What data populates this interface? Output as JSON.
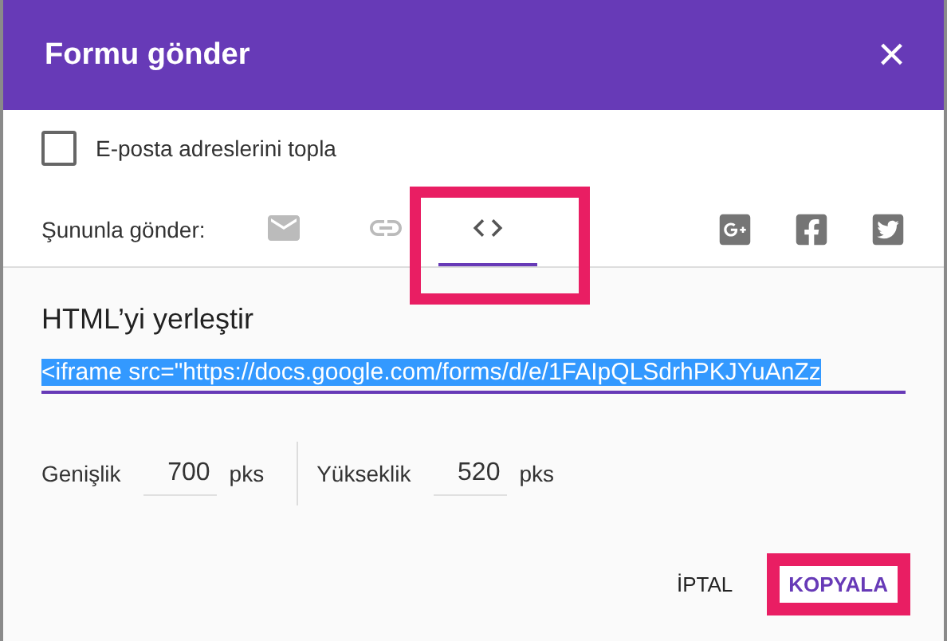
{
  "dialog": {
    "title": "Formu gönder",
    "close": "×"
  },
  "collect_emails": {
    "label": "E-posta adreslerini topla",
    "checked": false
  },
  "send_via": {
    "label": "Şununla gönder:",
    "tabs": [
      {
        "kind": "email",
        "selected": false,
        "highlighted": false
      },
      {
        "kind": "link",
        "selected": false,
        "highlighted": false
      },
      {
        "kind": "embed",
        "selected": true,
        "highlighted": true
      }
    ],
    "share": [
      {
        "kind": "googleplus"
      },
      {
        "kind": "facebook"
      },
      {
        "kind": "twitter"
      }
    ]
  },
  "embed": {
    "heading": "HTML’yi yerleştir",
    "code": "<iframe src=\"https://docs.google.com/forms/d/e/1FAIpQLSdrhPKJYuAnZz",
    "code_selected": true,
    "width": {
      "label": "Genişlik",
      "value": "700",
      "unit": "pks"
    },
    "height": {
      "label": "Yükseklik",
      "value": "520",
      "unit": "pks"
    }
  },
  "buttons": [
    {
      "label": "İPTAL",
      "primary": false,
      "highlighted": false
    },
    {
      "label": "KOPYALA",
      "primary": true,
      "highlighted": true
    }
  ]
}
